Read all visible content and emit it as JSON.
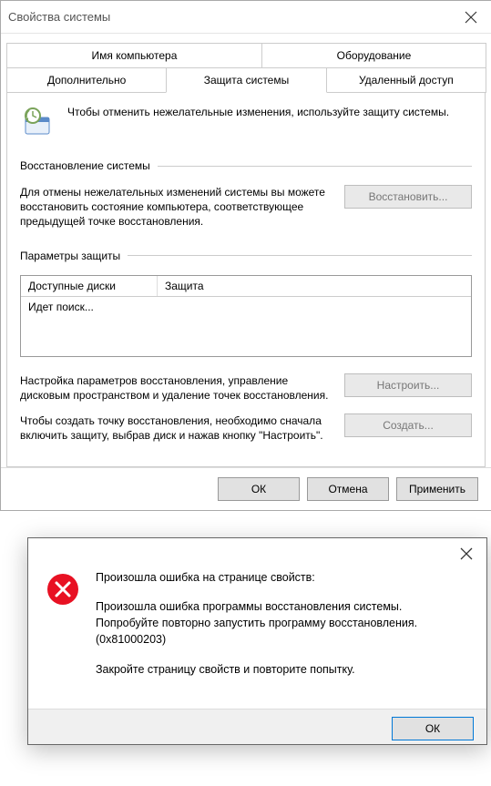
{
  "window": {
    "title": "Свойства системы"
  },
  "tabs": {
    "row1": {
      "computer_name": "Имя компьютера",
      "hardware": "Оборудование"
    },
    "row2": {
      "advanced": "Дополнительно",
      "protection": "Защита системы",
      "remote": "Удаленный доступ"
    }
  },
  "intro": "Чтобы отменить нежелательные изменения, используйте защиту системы.",
  "restore": {
    "heading": "Восстановление системы",
    "desc": "Для отмены нежелательных изменений системы вы можете восстановить состояние компьютера, соответствующее предыдущей точке восстановления.",
    "button": "Восстановить..."
  },
  "settings": {
    "heading": "Параметры защиты",
    "table": {
      "col1": "Доступные диски",
      "col2": "Защита",
      "status": "Идет поиск..."
    },
    "configure": {
      "desc": "Настройка параметров восстановления, управление дисковым пространством и удаление точек восстановления.",
      "button": "Настроить..."
    },
    "create": {
      "desc": "Чтобы создать точку восстановления, необходимо сначала включить защиту, выбрав диск и нажав кнопку \"Настроить\".",
      "button": "Создать..."
    }
  },
  "bottom": {
    "ok": "ОК",
    "cancel": "Отмена",
    "apply": "Применить"
  },
  "error": {
    "line1": "Произошла ошибка на странице свойств:",
    "line2": "Произошла ошибка программы восстановления системы. Попробуйте повторно запустить программу восстановления. (0x81000203)",
    "line3": "Закройте страницу свойств и повторите попытку.",
    "ok": "ОК"
  }
}
